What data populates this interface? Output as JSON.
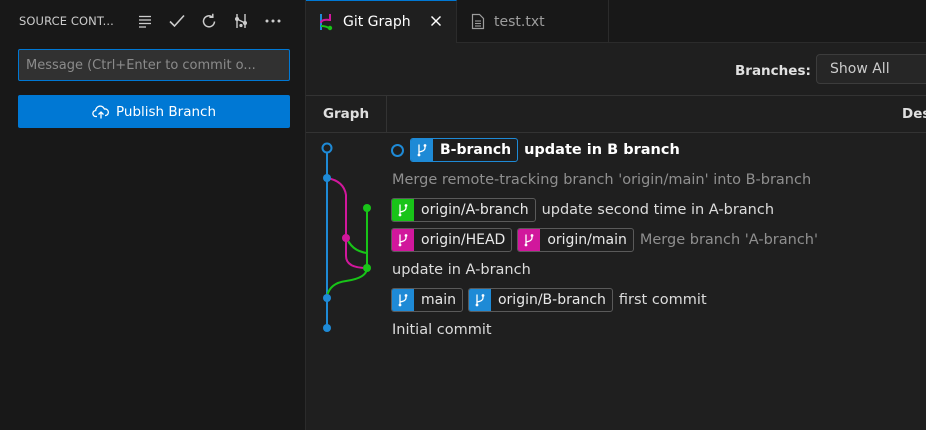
{
  "sidebar": {
    "title": "SOURCE CONT...",
    "actions": [
      {
        "icon": "view-as-tree-icon"
      },
      {
        "icon": "check-commit-icon"
      },
      {
        "icon": "refresh-icon"
      },
      {
        "icon": "git-graph-icon"
      },
      {
        "icon": "more-actions-icon"
      }
    ],
    "message_placeholder": "Message (Ctrl+Enter to commit o...",
    "message_value": "",
    "publish_label": "Publish Branch"
  },
  "tabs": [
    {
      "label": "Git Graph",
      "active": true
    },
    {
      "label": "test.txt",
      "active": false
    }
  ],
  "controls": {
    "branches_label": "Branches:",
    "branches_value": "Show All"
  },
  "table": {
    "col_graph": "Graph",
    "col_desc": "Des"
  },
  "colors": {
    "accent": "#0078d4",
    "branch_blue": "#1e8ad6",
    "branch_magenta": "#d1179c",
    "branch_green": "#18c418"
  },
  "commits": [
    {
      "refs": [
        {
          "name": "B-branch",
          "color": "#1e8ad6",
          "current": true
        }
      ],
      "message": "update in B branch"
    },
    {
      "refs": [],
      "message": "Merge remote-tracking branch 'origin/main' into B-branch"
    },
    {
      "refs": [
        {
          "name": "origin/A-branch",
          "color": "#18c418"
        }
      ],
      "message": "update second time in A-branch"
    },
    {
      "refs": [
        {
          "name": "origin/HEAD",
          "color": "#d1179c"
        },
        {
          "name": "origin/main",
          "color": "#d1179c"
        }
      ],
      "message": "Merge branch 'A-branch'"
    },
    {
      "refs": [],
      "message": "update in A-branch"
    },
    {
      "refs": [
        {
          "name": "main",
          "color": "#1e8ad6"
        },
        {
          "name": "origin/B-branch",
          "color": "#1e8ad6"
        }
      ],
      "message": "first commit"
    },
    {
      "refs": [],
      "message": "Initial commit"
    }
  ]
}
